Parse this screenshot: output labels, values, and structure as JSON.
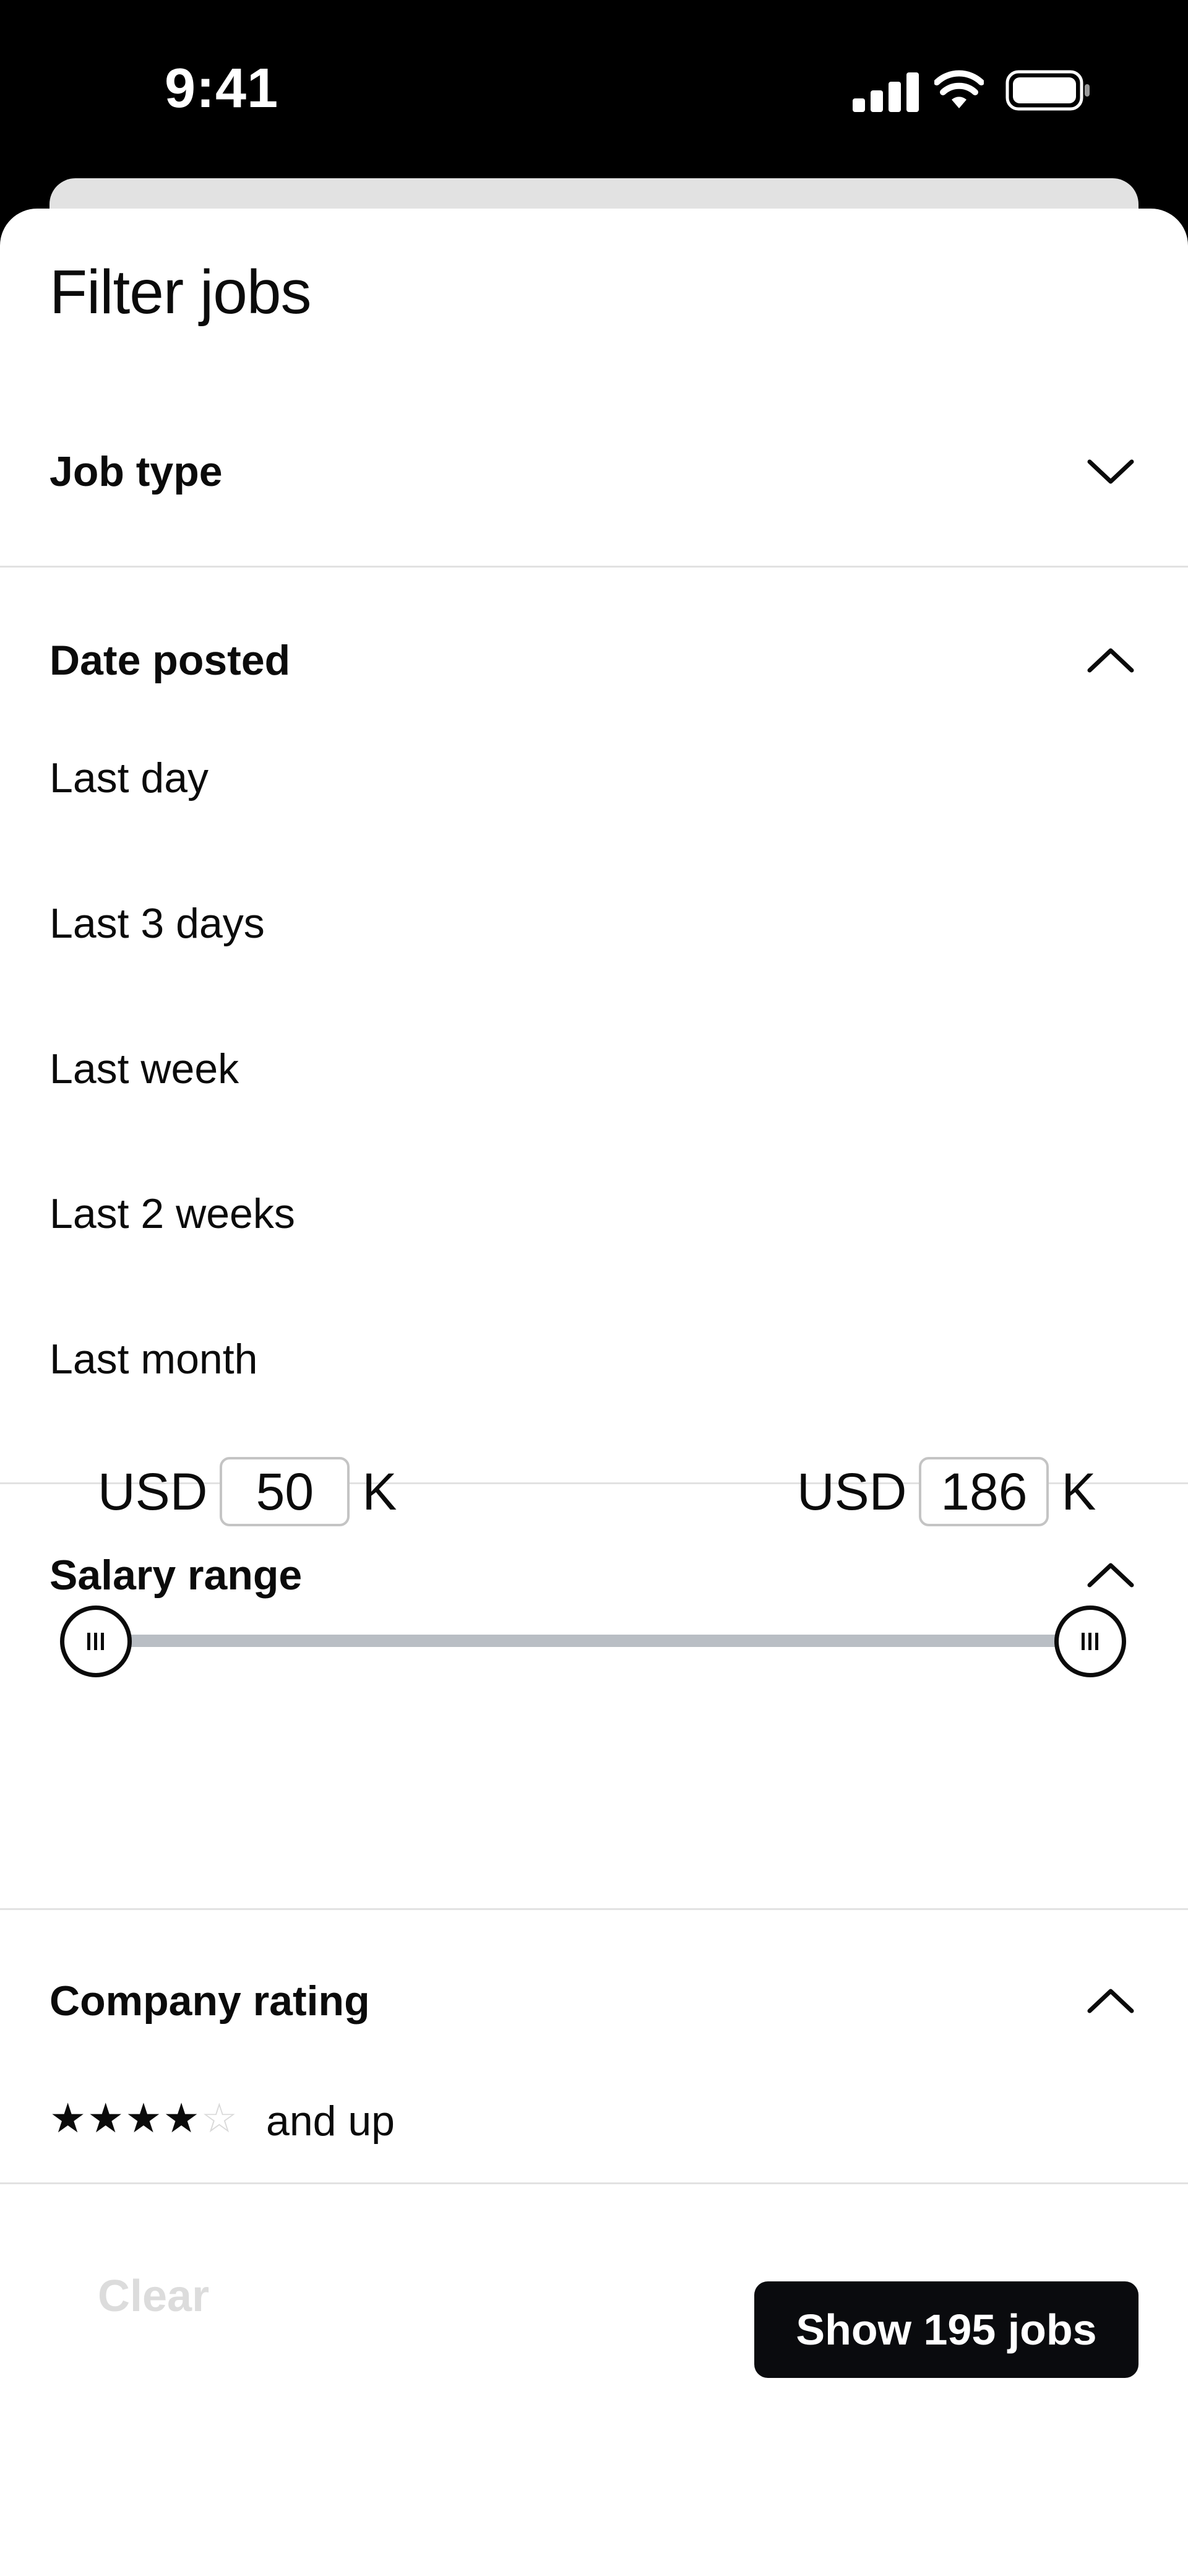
{
  "status_bar": {
    "time": "9:41",
    "icons": [
      "cellular-signal-icon",
      "wifi-icon",
      "battery-icon"
    ]
  },
  "sheet": {
    "title": "Filter jobs"
  },
  "sections": {
    "job_type": {
      "label": "Job type",
      "expanded": false
    },
    "date_posted": {
      "label": "Date posted",
      "expanded": true,
      "options": [
        "Last day",
        "Last 3 days",
        "Last week",
        "Last 2 weeks",
        "Last month"
      ]
    },
    "salary_range": {
      "label": "Salary range",
      "expanded": true,
      "currency": "USD",
      "unit": "K",
      "min": "50",
      "max": "186"
    },
    "company_rating": {
      "label": "Company rating",
      "expanded": true,
      "stars_filled": 4,
      "stars_total": 5,
      "suffix": "and up"
    }
  },
  "footer": {
    "clear_label": "Clear",
    "show_label": "Show 195 jobs"
  },
  "colors": {
    "text": "#0b0b0b",
    "divider": "#e2e2e2",
    "button_bg": "#0a0b0e",
    "disabled_text": "#dcdcdc",
    "slider_track": "#b9bec4"
  }
}
